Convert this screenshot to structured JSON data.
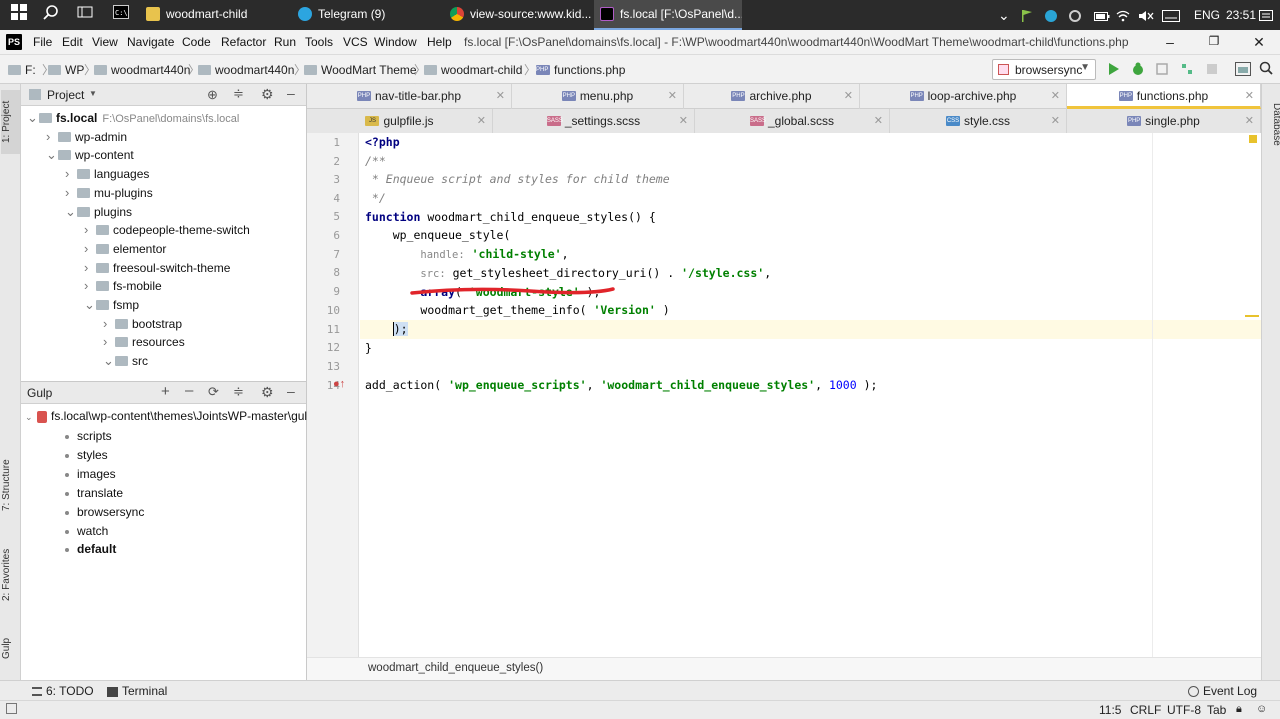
{
  "taskbar": {
    "apps": [
      {
        "label": "woodmart-child",
        "icon": "folder-icon"
      },
      {
        "label": "Telegram (9)",
        "icon": "telegram-icon"
      },
      {
        "label": "view-source:www.kid...",
        "icon": "chrome-icon"
      },
      {
        "label": "fs.local [F:\\OsPanel\\d...",
        "icon": "phpstorm-icon"
      }
    ],
    "language": "ENG",
    "time": "23:51"
  },
  "menu": {
    "items": [
      "File",
      "Edit",
      "View",
      "Navigate",
      "Code",
      "Refactor",
      "Run",
      "Tools",
      "VCS",
      "Window",
      "Help"
    ],
    "title": "fs.local [F:\\OsPanel\\domains\\fs.local] - F:\\WP\\woodmart440n\\woodmart440n\\WoodMart Theme\\woodmart-child\\functions.php"
  },
  "nav": {
    "crumbs": [
      "F:",
      "WP",
      "woodmart440n",
      "woodmart440n",
      "WoodMart Theme",
      "woodmart-child",
      "functions.php"
    ],
    "run_config": "browsersync"
  },
  "sidebar": {
    "left_tabs": [
      "1: Project",
      "7: Structure",
      "2: Favorites",
      "Gulp"
    ],
    "right_tabs": [
      "Database"
    ]
  },
  "project": {
    "title": "Project",
    "tree": [
      {
        "label": "fs.local",
        "hint": "F:\\OsPanel\\domains\\fs.local",
        "depth": 0,
        "open": true
      },
      {
        "label": "wp-admin",
        "depth": 1,
        "open": false
      },
      {
        "label": "wp-content",
        "depth": 1,
        "open": true
      },
      {
        "label": "languages",
        "depth": 2,
        "open": false
      },
      {
        "label": "mu-plugins",
        "depth": 2,
        "open": false
      },
      {
        "label": "plugins",
        "depth": 2,
        "open": true
      },
      {
        "label": "codepeople-theme-switch",
        "depth": 3,
        "open": false
      },
      {
        "label": "elementor",
        "depth": 3,
        "open": false
      },
      {
        "label": "freesoul-switch-theme",
        "depth": 3,
        "open": false
      },
      {
        "label": "fs-mobile",
        "depth": 3,
        "open": false
      },
      {
        "label": "fsmp",
        "depth": 3,
        "open": true
      },
      {
        "label": "bootstrap",
        "depth": 4,
        "open": false
      },
      {
        "label": "resources",
        "depth": 4,
        "open": false
      },
      {
        "label": "src",
        "depth": 4,
        "open": true
      }
    ]
  },
  "gulp": {
    "title": "Gulp",
    "root": "fs.local\\wp-content\\themes\\JointsWP-master\\gul",
    "tasks": [
      "scripts",
      "styles",
      "images",
      "translate",
      "browsersync",
      "watch",
      "default"
    ]
  },
  "tabs": {
    "row1": [
      "nav-title-bar.php",
      "menu.php",
      "archive.php",
      "loop-archive.php",
      "functions.php"
    ],
    "row2": [
      "gulpfile.js",
      "_settings.scss",
      "_global.scss",
      "style.css",
      "single.php"
    ]
  },
  "code": {
    "lines": [
      "1",
      "2",
      "3",
      "4",
      "5",
      "6",
      "7",
      "8",
      "9",
      "10",
      "11",
      "12",
      "13",
      "14"
    ],
    "l1": "<?php",
    "l2": "/**",
    "l3": " * Enqueue script and styles for child theme",
    "l4": " */",
    "l5_kw": "function",
    "l5_rest": " woodmart_child_enqueue_styles() {",
    "l6": "    wp_enqueue_style(",
    "l7_hint": "handle:",
    "l7_str": "'child-style'",
    "l8_hint": "src:",
    "l8_fn": "get_stylesheet_directory_uri() . ",
    "l8_str": "'/style.css'",
    "l9_kw": "array",
    "l9_str": "'woodmart-style'",
    "l10_fn": "woodmart_get_theme_info(",
    "l10_str": "'Version'",
    "l11": ");",
    "l12": "}",
    "l14_fn": "add_action(",
    "l14_s1": "'wp_enqueue_scripts'",
    "l14_s2": "'woodmart_child_enqueue_styles'",
    "l14_num": "1000"
  },
  "editor_breadcrumb": "woodmart_child_enqueue_styles()",
  "bottom_tools": {
    "todo": "6: TODO",
    "terminal": "Terminal",
    "event_log": "Event Log"
  },
  "status": {
    "position": "11:5",
    "line_sep": "CRLF",
    "encoding": "UTF-8",
    "indent": "Tab"
  }
}
